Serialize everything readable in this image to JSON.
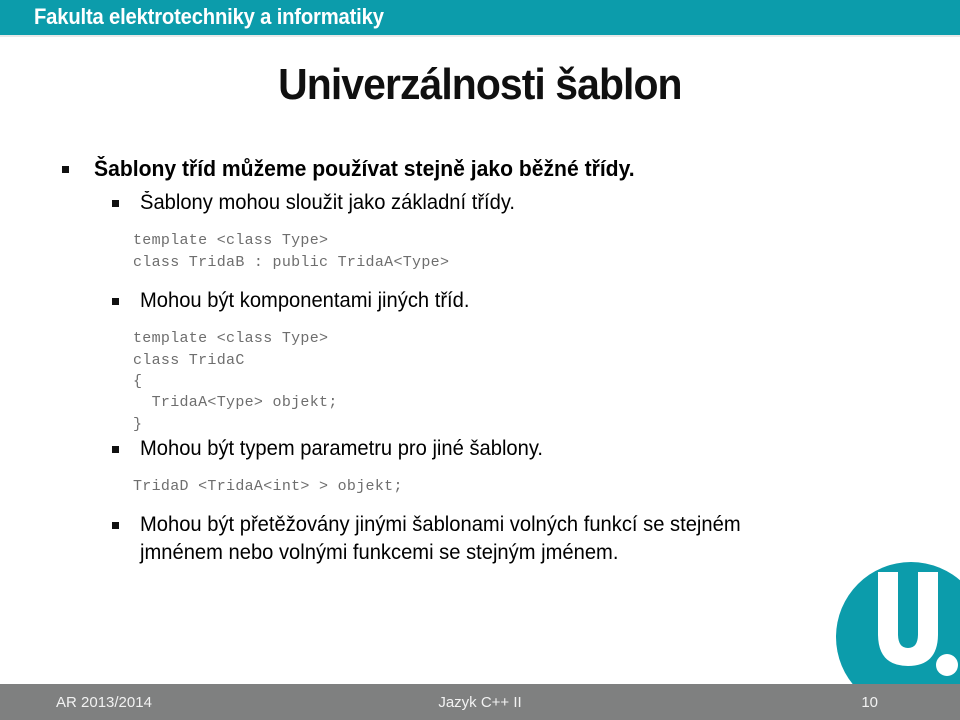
{
  "header": {
    "faculty": "Fakulta elektrotechniky a informatiky",
    "band_color": "#0C9CAB"
  },
  "title": "Univerzálnosti šablon",
  "content": {
    "bullet1": "Šablony tříd můžeme používat stejně jako běžné třídy.",
    "bullet2": "Šablony mohou sloužit jako základní třídy.",
    "code1": "template <class Type>\nclass TridaB : public TridaA<Type>",
    "bullet3": "Mohou být komponentami jiných tříd.",
    "code2": "template <class Type>\nclass TridaC\n{\n  TridaA<Type> objekt;\n}",
    "bullet4": "Mohou být typem parametru pro jiné šablony.",
    "code3": "TridaD <TridaA<int> > objekt;",
    "bullet5": "Mohou být přetěžovány jinými šablonami volných funkcí se stejném jmnénem nebo volnými funkcemi se stejným jménem."
  },
  "logo": {
    "letter": "U",
    "circle_color": "#0C9CAB",
    "dot_color": "#ffffff",
    "small_dot_color": "#8a8a8a"
  },
  "footer": {
    "left": "AR 2013/2014",
    "center": "Jazyk C++ II",
    "page": "10",
    "band_color": "#7f8080"
  }
}
